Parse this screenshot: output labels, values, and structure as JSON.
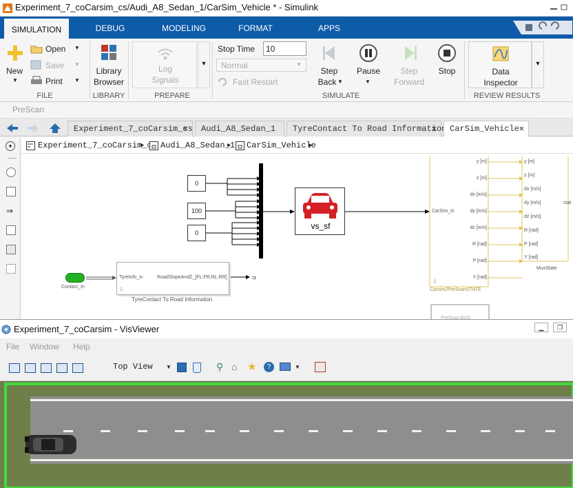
{
  "window": {
    "title": "Experiment_7_coCarsim_cs/Audi_A8_Sedan_1/CarSim_Vehicle * - Simulink"
  },
  "ribbon_tabs": [
    "SIMULATION",
    "DEBUG",
    "MODELING",
    "FORMAT",
    "APPS"
  ],
  "ribbon": {
    "file": {
      "new": "New",
      "open": "Open",
      "save": "Save",
      "print": "Print",
      "label": "FILE"
    },
    "library": {
      "browser_line1": "Library",
      "browser_line2": "Browser",
      "label": "LIBRARY"
    },
    "prepare": {
      "log_line1": "Log",
      "log_line2": "Signals",
      "label": "PREPARE"
    },
    "simulate": {
      "stop_time_label": "Stop Time",
      "stop_time_value": "10",
      "mode_value": "Normal",
      "fast_restart": "Fast Restart",
      "step_back_line1": "Step",
      "step_back_line2": "Back",
      "pause": "Pause",
      "step_forward_line1": "Step",
      "step_forward_line2": "Forward",
      "stop": "Stop",
      "label": "SIMULATE"
    },
    "review": {
      "inspector_line1": "Data",
      "inspector_line2": "Inspector",
      "label": "REVIEW RESULTS"
    }
  },
  "prescan_label": "PreScan",
  "doc_tabs": [
    {
      "label": "Experiment_7_coCarsim_cs",
      "active": false
    },
    {
      "label": "Audi_A8_Sedan_1",
      "active": false
    },
    {
      "label": "TyreContact To Road Information",
      "active": false
    },
    {
      "label": "CarSim_Vehicle",
      "active": true
    }
  ],
  "breadcrumb": [
    "Experiment_7_coCarsim_cs",
    "Audi_A8_Sedan_1",
    "CarSim_Vehicle"
  ],
  "diagram": {
    "constants": [
      "0",
      "100",
      "0"
    ],
    "sfun_label": "vs_sf",
    "carsim_in_label": "CarSim_in",
    "carsim_outputs": [
      "y [m]",
      "z [m]",
      "dx [m/s]",
      "dy [m/s]",
      "dz [m/s]",
      "R [rad]",
      "P [rad]",
      "Y [rad]"
    ],
    "mux_inputs": [
      "y [m]",
      "z [m]",
      "dx [m/s]",
      "dy [m/s]",
      "dz [m/s]",
      "R [rad]",
      "P [rad]",
      "Y [rad]"
    ],
    "mux_state_label": "MuxState",
    "stat_label": "stat",
    "carsim_block_name": "Carsim2PreScanSTATE",
    "contact_label": "Contact_In",
    "tyre_in_port": "TyreInfo_in",
    "tyre_out_port": "RoadSlopeAndZ_[FL;FR;RL;RR]",
    "tyre_block_name": "TyreContact To Road Information",
    "bus_partial": "PreScan BUS"
  },
  "visviewer": {
    "title": "Experiment_7_coCarsim - VisViewer",
    "menu": [
      "File",
      "Window",
      "Help"
    ],
    "view_select": "Top View"
  },
  "colors": {
    "ribbon_blue": "#0e5ba8",
    "sfun_car_red": "#d42027",
    "carsim_signal_yellow": "#e1c45a",
    "contact_green": "#22b122",
    "grass": "#6f7f4a",
    "road": "#8e8f8c"
  }
}
